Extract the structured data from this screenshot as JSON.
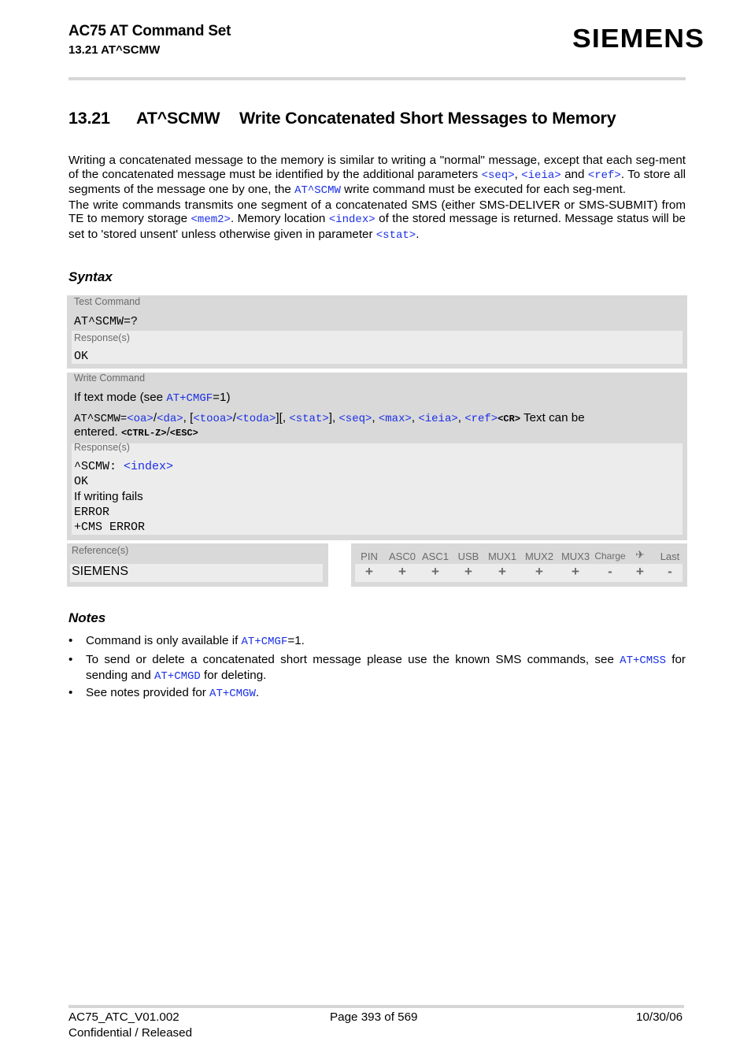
{
  "header": {
    "title": "AC75 AT Command Set",
    "subtitle": "13.21 AT^SCMW",
    "logo": "SIEMENS"
  },
  "section": {
    "number": "13.21",
    "command": "AT^SCMW",
    "title": "Write Concatenated Short Messages to Memory"
  },
  "intro": {
    "p1_a": "Writing a concatenated message to the memory is similar to writing a \"normal\" message, except that each seg-ment of the concatenated message must be identified by the additional parameters ",
    "p1_link_seq": "<seq>",
    "p1_comma": ", ",
    "p1_link_ieia": "<ieia>",
    "p1_and": " and ",
    "p1_link_ref": "<ref>",
    "p1_b": ". To store all segments of the message one by one, the ",
    "p1_link_cmd": "AT^SCMW",
    "p1_c": " write command must be executed for each seg-ment.",
    "p2_a": "The write commands transmits one segment of a concatenated SMS (either SMS-DELIVER or SMS-SUBMIT) from TE to memory storage ",
    "p2_link_mem2": "<mem2>",
    "p2_b": ". Memory location ",
    "p2_link_index": "<index>",
    "p2_c": " of the stored message is returned. Message status will be set to 'stored unsent' unless otherwise given in parameter ",
    "p2_link_stat": "<stat>",
    "p2_d": "."
  },
  "syntax": {
    "heading": "Syntax",
    "test": {
      "label": "Test Command",
      "command": "AT^SCMW=?",
      "response_label": "Response(s)",
      "response": "OK"
    },
    "write": {
      "label": "Write Command",
      "mode_text": "If text mode (see ",
      "mode_link": "AT+CMGF",
      "mode_end": "=1)",
      "cmd_prefix": "AT^SCMW=",
      "p_oa": "<oa>",
      "slash1": "/",
      "p_da": "<da>",
      "sep1": ", [",
      "p_tooa": "<tooa>",
      "slash2": "/",
      "p_toda": "<toda>",
      "sep2": "][, ",
      "p_stat": "<stat>",
      "sep3": "], ",
      "p_seq": "<seq>",
      "sep4": ", ",
      "p_max": "<max>",
      "sep5": ", ",
      "p_ieia": "<ieia>",
      "sep6": ", ",
      "p_ref": "<ref>",
      "cr": "<CR>",
      "text_after": " Text can be",
      "entered": "entered. ",
      "ctrlz": "<CTRL-Z>",
      "slash3": "/",
      "esc": "<ESC>",
      "response_label": "Response(s)",
      "resp1_prefix": "^SCMW: ",
      "resp1_link": "<index>",
      "resp2": "OK",
      "resp3": "If writing fails",
      "resp4": "ERROR",
      "resp5": "+CMS ERROR"
    },
    "reference": {
      "label": "Reference(s)",
      "value": "SIEMENS"
    },
    "pin_table": {
      "headers": [
        "PIN",
        "ASC0",
        "ASC1",
        "USB",
        "MUX1",
        "MUX2",
        "MUX3",
        "Charge",
        "airplane-icon",
        "Last"
      ],
      "values": [
        "+",
        "+",
        "+",
        "+",
        "+",
        "+",
        "+",
        "-",
        "+",
        "-"
      ]
    }
  },
  "notes": {
    "heading": "Notes",
    "items": [
      {
        "a": "Command is only available if ",
        "link": "AT+CMGF",
        "b": "=1."
      },
      {
        "a": "To send or delete a concatenated short message please use the known SMS commands, see ",
        "link": "AT+CMSS",
        "b": " for sending and ",
        "link2": "AT+CMGD",
        "c": " for deleting."
      },
      {
        "a": "See notes provided for ",
        "link": "AT+CMGW",
        "b": "."
      }
    ],
    "bullet": "•"
  },
  "footer": {
    "doc_id": "AC75_ATC_V01.002",
    "status": "Confidential / Released",
    "page": "Page 393 of 569",
    "date": "10/30/06"
  },
  "colors": {
    "link": "#1a2fe6",
    "box_outer": "#d9d9d9",
    "box_inner": "#ececec",
    "label_gray": "#6b6b6b"
  }
}
